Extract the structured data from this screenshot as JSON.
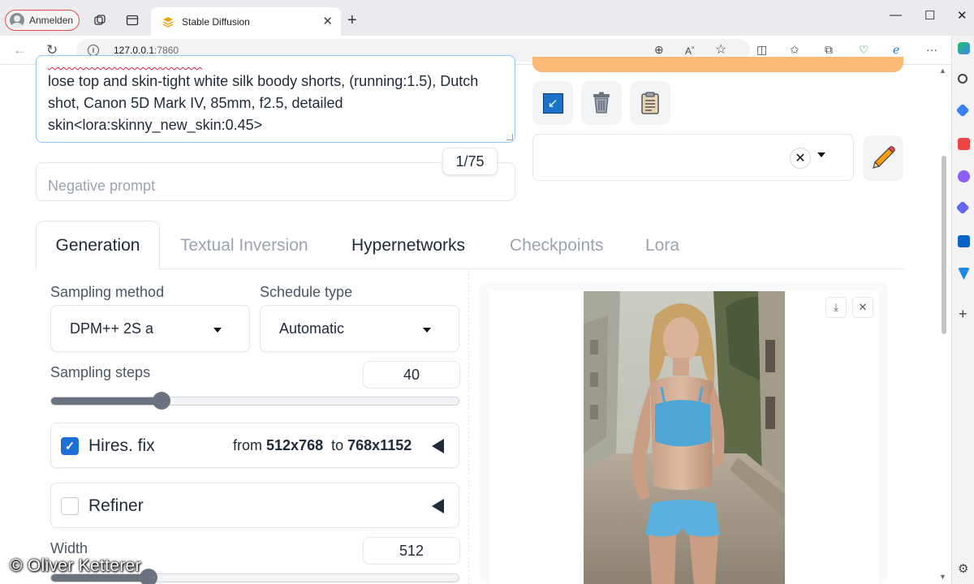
{
  "browser": {
    "profile_label": "Anmelden",
    "tab_title": "Stable Diffusion",
    "url_host": "127.0.0.1",
    "url_port": ":7860"
  },
  "prompt": {
    "line1": "lose top and skin-tight white silk boody shorts, (running:1.5), Dutch",
    "line2": "shot, Canon 5D Mark IV, 85mm, f2.5, detailed",
    "line3": "skin<lora:skinny_new_skin:0.45>",
    "token_counter": "1/75"
  },
  "negative_prompt": {
    "placeholder": "Negative prompt"
  },
  "tabs": [
    {
      "label": "Generation",
      "state": "active"
    },
    {
      "label": "Textual Inversion",
      "state": "disabled"
    },
    {
      "label": "Hypernetworks",
      "state": "normal"
    },
    {
      "label": "Checkpoints",
      "state": "disabled"
    },
    {
      "label": "Lora",
      "state": "disabled"
    }
  ],
  "generation": {
    "sampling_method_label": "Sampling method",
    "sampling_method_value": "DPM++ 2S a",
    "schedule_type_label": "Schedule type",
    "schedule_type_value": "Automatic",
    "sampling_steps_label": "Sampling steps",
    "sampling_steps_value": "40",
    "sampling_steps_fraction": 0.27,
    "hires_fix": {
      "label": "Hires. fix",
      "checked": true,
      "from_text": "from",
      "from_size": "512x768",
      "to_text": "to",
      "to_size": "768x1152"
    },
    "refiner": {
      "label": "Refiner",
      "checked": false
    },
    "width_label": "Width",
    "width_value": "512",
    "width_fraction": 0.24
  },
  "colors": {
    "accent": "#1d6fd6",
    "generate_button": "#fdba74",
    "error_squiggle": "#e11d48"
  },
  "icons": [
    "profile-icon",
    "workspaces-icon",
    "tab-actions-icon",
    "stable-diffusion-favicon",
    "close-icon",
    "new-tab-icon",
    "minimize-icon",
    "maximize-icon",
    "back-icon",
    "refresh-icon",
    "info-icon",
    "zoom-icon",
    "read-aloud-icon",
    "favorite-icon",
    "split-screen-icon",
    "favorites-list-icon",
    "collections-icon",
    "browser-essentials-icon",
    "edge-copilot-icon",
    "more-icon",
    "paste-icon",
    "trash-icon",
    "clipboard-icon",
    "pencil-icon",
    "download-icon",
    "settings-icon"
  ],
  "watermark": "© Oliver Ketterer"
}
